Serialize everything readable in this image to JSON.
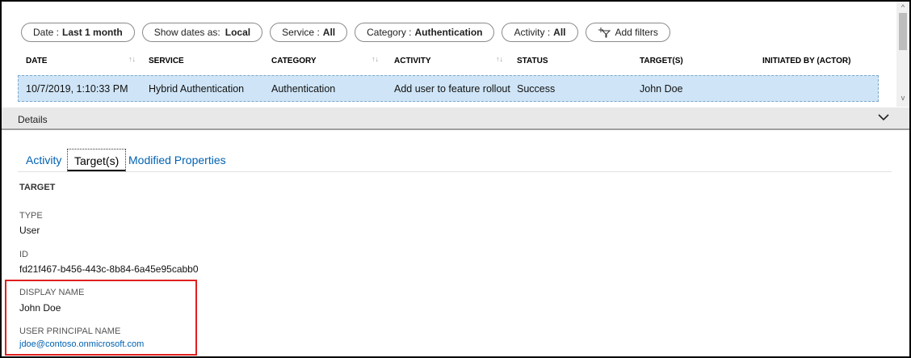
{
  "filters": [
    {
      "label": "Date :",
      "value": "Last 1 month"
    },
    {
      "label": "Show dates as:",
      "value": "Local"
    },
    {
      "label": "Service :",
      "value": "All"
    },
    {
      "label": "Category :",
      "value": "Authentication"
    },
    {
      "label": "Activity :",
      "value": "All"
    }
  ],
  "add_filters_label": "Add filters",
  "columns": {
    "date": "DATE",
    "service": "SERVICE",
    "category": "CATEGORY",
    "activity": "ACTIVITY",
    "status": "STATUS",
    "targets": "TARGET(S)",
    "initiated_by": "INITIATED BY (ACTOR)"
  },
  "row": {
    "date": "10/7/2019, 1:10:33 PM",
    "service": "Hybrid Authentication",
    "category": "Authentication",
    "activity": "Add user to feature rollout",
    "status": "Success",
    "targets": "John Doe",
    "initiated_by": ""
  },
  "details": {
    "label": "Details",
    "tabs": [
      "Activity",
      "Target(s)",
      "Modified Properties"
    ],
    "active_tab": "Target(s)"
  },
  "target": {
    "section_title": "TARGET",
    "fields": [
      {
        "label": "TYPE",
        "value": "User"
      },
      {
        "label": "ID",
        "value": "fd21f467-b456-443c-8b84-6a45e95cabb0"
      },
      {
        "label": "DISPLAY NAME",
        "value": "John Doe"
      },
      {
        "label": "USER PRINCIPAL NAME",
        "value": "jdoe@contoso.onmicrosoft.com"
      }
    ]
  },
  "colors": {
    "selected_row": "#cfe5f7",
    "link": "#0062b3",
    "highlight_box": "#e01e1e"
  }
}
